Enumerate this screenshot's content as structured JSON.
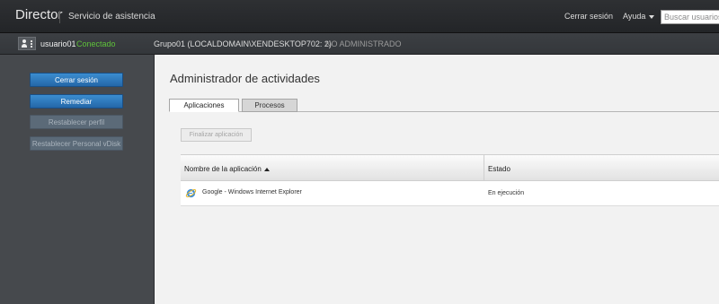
{
  "header": {
    "brand": "Director",
    "subtitle": "Servicio de asistencia",
    "logout_label": "Cerrar sesión",
    "help_label": "Ayuda",
    "search_placeholder": "Buscar usuarios"
  },
  "userbar": {
    "username": "usuario01",
    "status": "Conectado",
    "status_color": "#5fc23a",
    "machine": "Grupo01 (LOCALDOMAIN\\XENDESKTOP702: 2)",
    "admin_label": "NO ADMINISTRADO"
  },
  "sidebar": {
    "buttons": [
      {
        "label": "Cerrar sesión",
        "enabled": true
      },
      {
        "label": "Remediar",
        "enabled": true
      },
      {
        "label": "Restablecer perfil",
        "enabled": false
      },
      {
        "label": "Restablecer Personal vDisk",
        "enabled": false
      }
    ],
    "accent_color": "#2f7bc0"
  },
  "main": {
    "title": "Administrador de actividades",
    "tabs": [
      {
        "label": "Aplicaciones",
        "active": true
      },
      {
        "label": "Procesos",
        "active": false
      }
    ],
    "end_button_label": "Finalizar aplicación",
    "table": {
      "columns": [
        "Nombre de la aplicación",
        "Estado"
      ],
      "sort": "ascending",
      "rows": [
        {
          "icon": "internet-explorer-icon",
          "name": "Google - Windows Internet Explorer",
          "status": "En ejecución"
        }
      ]
    }
  }
}
